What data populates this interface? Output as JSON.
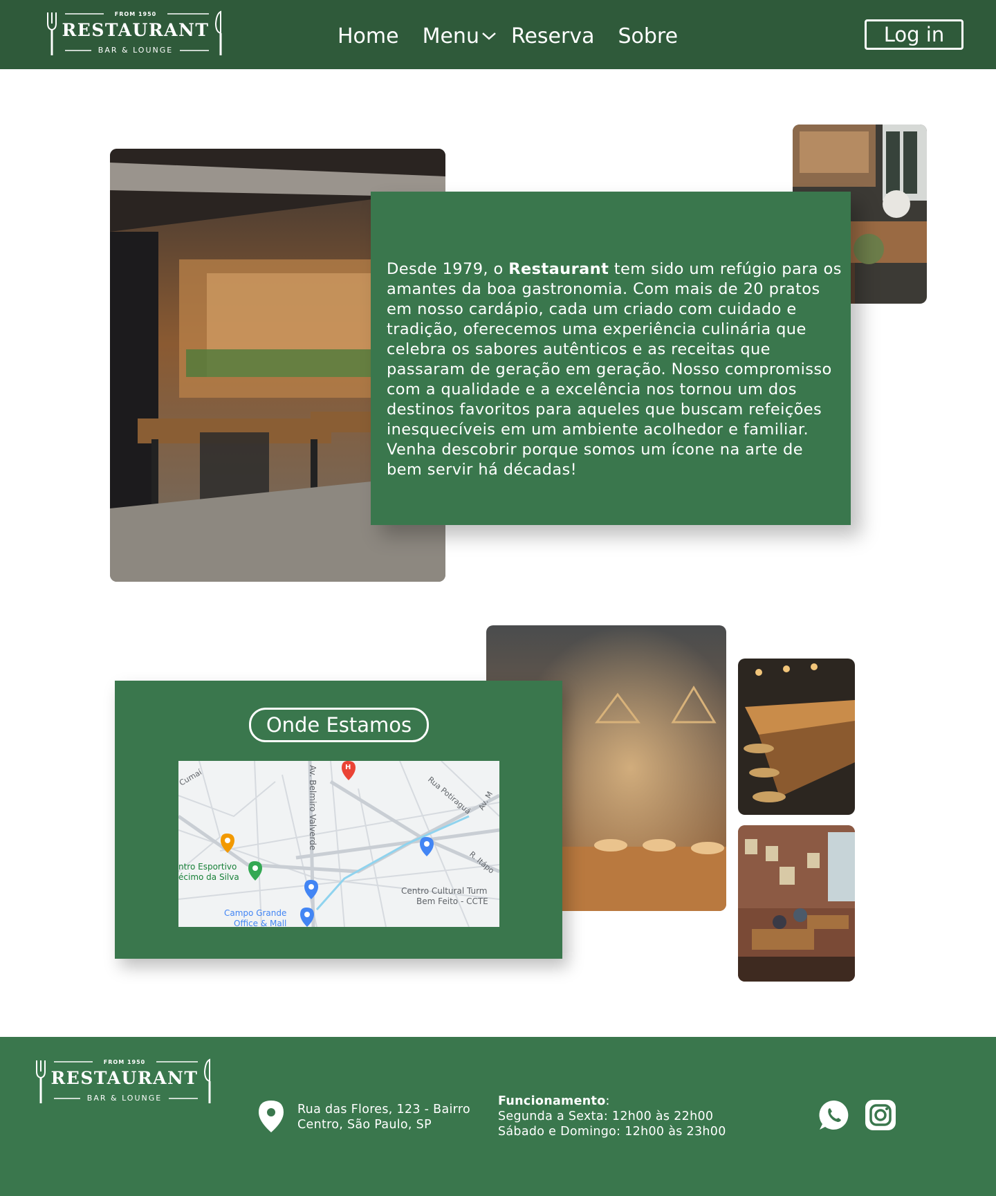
{
  "header": {
    "logo": {
      "from": "FROM 1950",
      "name": "RESTAURANT",
      "sub": "BAR & LOUNGE"
    },
    "nav": [
      {
        "label": "Home"
      },
      {
        "label": "Menu",
        "has_dropdown": true
      },
      {
        "label": "Reserva"
      },
      {
        "label": "Sobre"
      }
    ],
    "login_label": "Log in"
  },
  "about": {
    "text_before": "Desde 1979, o ",
    "brand": "Restaurant",
    "text_after": " tem sido um refúgio para os amantes da boa gastronomia. Com mais de 20 pratos em nosso cardápio, cada um criado com cuidado e tradição, oferecemos uma experiência culinária que celebra os sabores autênticos e as receitas que passaram de geração em geração. Nosso compromisso com a qualidade e a excelência nos tornou um dos destinos favoritos para aqueles que buscam refeições inesquecíveis em um ambiente acolhedor e familiar. Venha descobrir porque somos um ícone na arte de bem servir há décadas!"
  },
  "location": {
    "title": "Onde Estamos",
    "map_labels": {
      "street1": "Av. Belmiro Valverde",
      "street2": "Rua Potiraguá",
      "street3": "Cumaí",
      "street4": "R. Itápo",
      "street5": "Av. M",
      "place1_l1": "ntro Esportivo",
      "place1_l2": "écimo da Silva",
      "place2_l1": "Centro Cultural Turm",
      "place2_l2": "Bem Feito - CCTE",
      "place3_l1": "Campo Grande",
      "place3_l2": "Office & Mall"
    }
  },
  "footer": {
    "logo": {
      "from": "FROM 1950",
      "name": "RESTAURANT",
      "sub": "BAR & LOUNGE"
    },
    "address": "Rua das Flores, 123 - Bairro Centro, São Paulo, SP",
    "hours_title": "Funcionamento",
    "hours_sep": ":",
    "hours_weekdays": "Segunda a Sexta: 12h00 às 22h00",
    "hours_weekend": "Sábado e Domingo: 12h00 às 23h00"
  },
  "colors": {
    "header_bg": "#2f5a3a",
    "green": "#3a774d",
    "white": "#ffffff"
  },
  "icons": [
    "fork-icon",
    "knife-icon",
    "chevron-down-icon",
    "map-pin-icon",
    "whatsapp-icon",
    "instagram-icon"
  ]
}
